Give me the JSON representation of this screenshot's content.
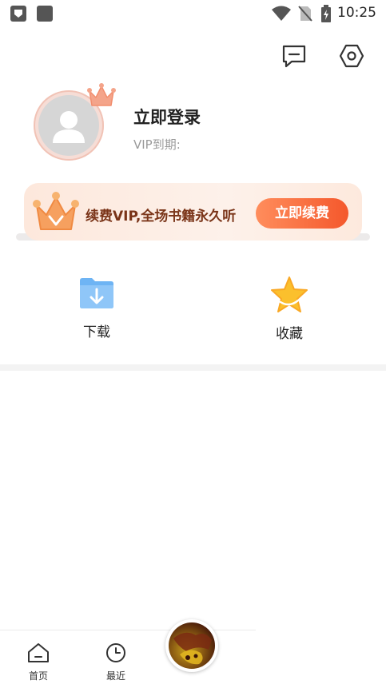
{
  "status_bar": {
    "time": "10:25",
    "icons": [
      "shield-icon",
      "square-icon",
      "wifi-icon",
      "no-sim-icon",
      "battery-icon"
    ]
  },
  "header": {
    "actions": [
      "message-icon",
      "settings-icon"
    ]
  },
  "profile": {
    "login_label": "立即登录",
    "vip_expiry_label": "VIP到期:"
  },
  "vip_banner": {
    "text": "续费VIP,全场书籍永久听",
    "button_label": "立即续费"
  },
  "quick_actions": [
    {
      "label": "下载",
      "icon": "download-folder-icon"
    },
    {
      "label": "收藏",
      "icon": "star-icon"
    }
  ],
  "bottom_nav": {
    "items": [
      {
        "label": "首页",
        "icon": "home-icon"
      },
      {
        "label": "最近",
        "icon": "clock-icon"
      }
    ]
  },
  "colors": {
    "accent": "#f4582c",
    "banner_bg": "#fde8dc",
    "banner_text": "#7a3418"
  }
}
